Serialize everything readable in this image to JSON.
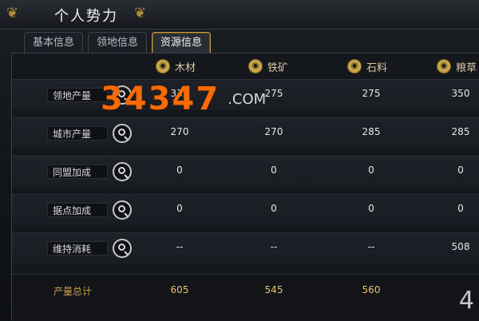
{
  "title": "个人势力",
  "tabs": [
    {
      "label": "基本信息"
    },
    {
      "label": "领地信息"
    },
    {
      "label": "资源信息"
    }
  ],
  "columns": [
    {
      "label": "木材",
      "icon": "wood-icon"
    },
    {
      "label": "铁矿",
      "icon": "iron-icon"
    },
    {
      "label": "石料",
      "icon": "stone-icon"
    },
    {
      "label": "粮草",
      "icon": "grain-icon"
    }
  ],
  "rows": [
    {
      "label": "领地产量",
      "values": [
        "335",
        "275",
        "275",
        "350"
      ]
    },
    {
      "label": "城市产量",
      "values": [
        "270",
        "270",
        "285",
        "285"
      ]
    },
    {
      "label": "同盟加成",
      "values": [
        "0",
        "0",
        "0",
        "0"
      ]
    },
    {
      "label": "据点加成",
      "values": [
        "0",
        "0",
        "0",
        "0"
      ]
    },
    {
      "label": "维持消耗",
      "values": [
        "--",
        "--",
        "--",
        "508"
      ]
    }
  ],
  "totals": {
    "label": "产量总计",
    "values": [
      "605",
      "545",
      "560",
      ""
    ]
  },
  "watermark": {
    "number": "34347",
    "domain": ".COM"
  },
  "icons": {
    "magnifier": "magnifier-icon",
    "column_icon_color": "#c7a547",
    "accent_orange": "#ff6a00"
  }
}
